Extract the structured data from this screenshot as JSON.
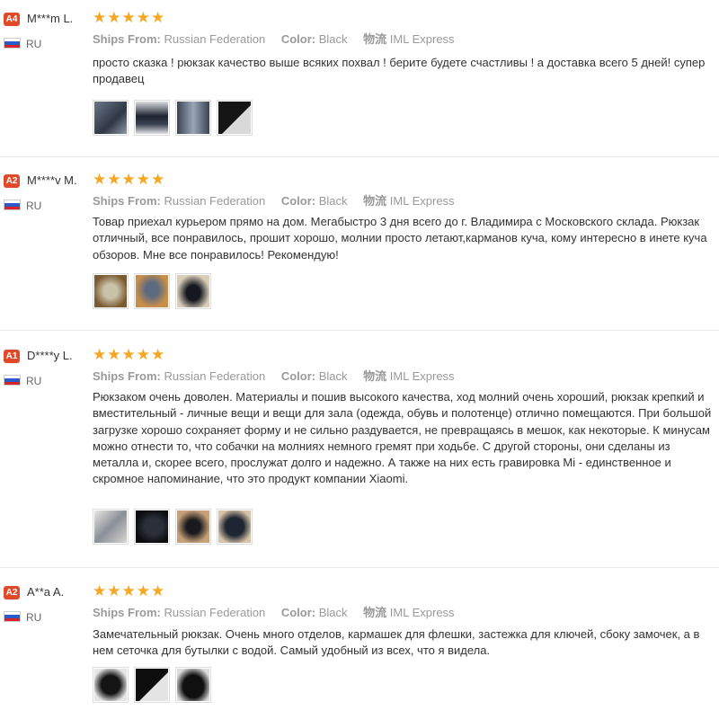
{
  "labels": {
    "ships_from": "Ships From:",
    "color": "Color:",
    "shipping": "物流"
  },
  "reviews": [
    {
      "badge": "A4",
      "name": "M***m L.",
      "country": "RU",
      "ships_from": "Russian Federation",
      "color": "Black",
      "shipping": "IML Express",
      "rating": 5,
      "text": "просто сказка ! рюкзак качество выше всяких похвал ! берите будете счастливы ! а доставка всего 5 дней! супер продавец",
      "photos": [
        "backpack-photo-1",
        "backpack-photo-2",
        "backpack-photo-3",
        "backpack-photo-4"
      ]
    },
    {
      "badge": "A2",
      "name": "M****v M.",
      "country": "RU",
      "ships_from": "Russian Federation",
      "color": "Black",
      "shipping": "IML Express",
      "rating": 5,
      "text": "Товар приехал курьером прямо на дом. Мегабыстро 3 дня всего до г. Владимира с Московского склада. Рюкзак отличный, все понравилось, прошит хорошо, молнии просто летают,карманов куча, кому интересно в инете куча обзоров. Мне все понравилось! Рекомендую!",
      "photos": [
        "backpack-photo-1",
        "backpack-photo-2",
        "backpack-photo-3"
      ]
    },
    {
      "badge": "A1",
      "name": "D****y L.",
      "country": "RU",
      "ships_from": "Russian Federation",
      "color": "Black",
      "shipping": "IML Express",
      "rating": 5,
      "text": "Рюкзаком очень доволен. Материалы и пошив высокого качества, ход молний очень хороший, рюкзак крепкий и вместительный - личные вещи и вещи для зала (одежда, обувь и полотенце) отлично помещаются. При большой загрузке хорошо сохраняет форму и не сильно раздувается, не превращаясь в мешок, как некоторые. К минусам можно отнести то, что собачки на молниях немного гремят при ходьбе. С другой стороны, они сделаны из металла и, скорее всего, прослужат долго и надежно. А также на них есть гравировка Mi - единственное и скромное напоминание, что это продукт компании Xiaomi.",
      "photos": [
        "backpack-photo-1",
        "backpack-photo-2",
        "backpack-photo-3",
        "backpack-photo-4"
      ]
    },
    {
      "badge": "A2",
      "name": "A**a A.",
      "country": "RU",
      "ships_from": "Russian Federation",
      "color": "Black",
      "shipping": "IML Express",
      "rating": 5,
      "text": "Замечательный рюкзак. Очень много отделов, кармашек для флешки, застежка для ключей, сбоку замочек, а в нем сеточка для бутылки с водой. Самый удобный из всех, что я видела.",
      "photos": [
        "backpack-photo-1",
        "backpack-photo-2",
        "backpack-photo-3"
      ]
    }
  ],
  "colors": {
    "badge": "#e04a2a",
    "star": "#f5a623",
    "name": "#333333"
  }
}
